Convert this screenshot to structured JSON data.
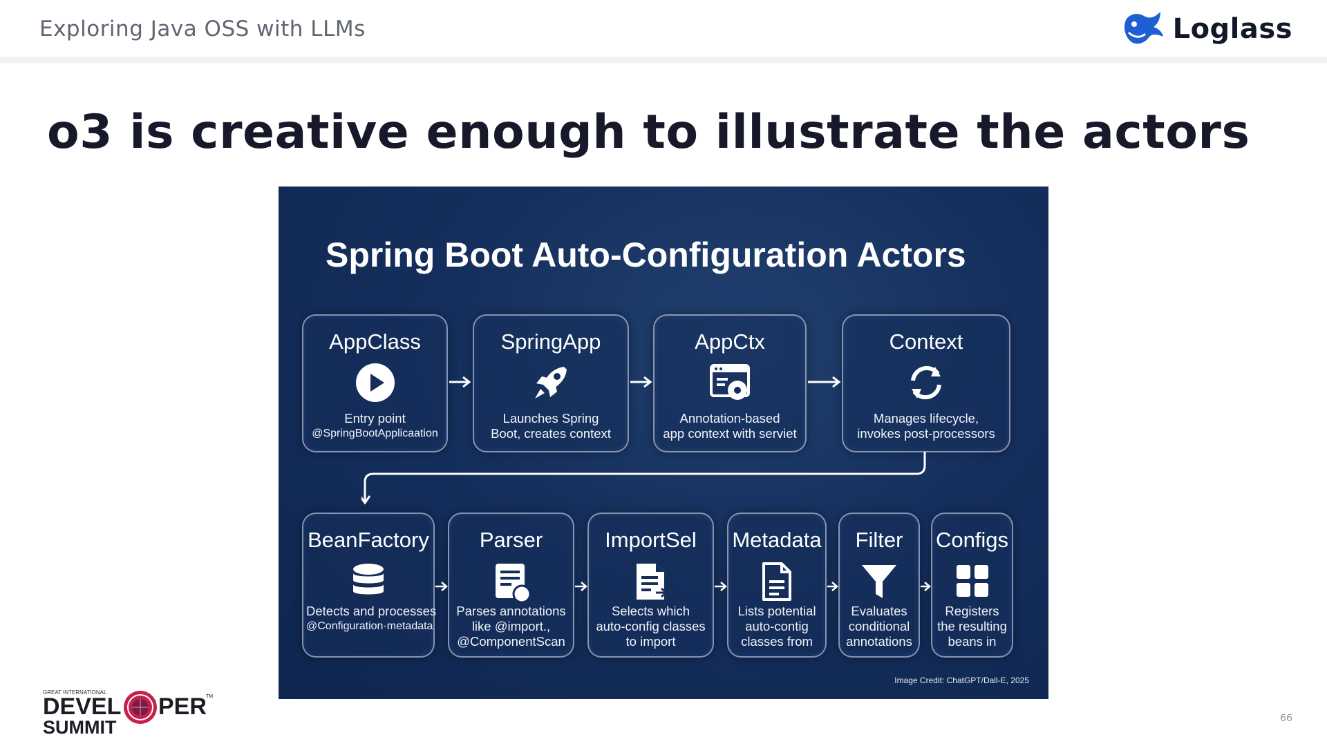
{
  "header": {
    "title": "Exploring Java OSS with LLMs",
    "brand": "Loglass"
  },
  "slide": {
    "title": "o3 is creative enough to illustrate the actors",
    "page_number": "66"
  },
  "figure": {
    "title": "Spring Boot Auto-Configuration Actors",
    "credit": "Image Credit: ChatGPT/Dall-E, 2025",
    "top_row": [
      {
        "title": "AppClass",
        "icon": "play-icon",
        "desc": [
          "Entry point",
          "@SpringBootApplicaation"
        ]
      },
      {
        "title": "SpringApp",
        "icon": "rocket-icon",
        "desc": [
          "Launches Spring",
          "Boot, creates context"
        ]
      },
      {
        "title": "AppCtx",
        "icon": "app-window-gear-icon",
        "desc": [
          "Annotation-based",
          "app context with serviet"
        ]
      },
      {
        "title": "Context",
        "icon": "refresh-cycle-icon",
        "desc": [
          "Manages lifecycle,",
          "invokes post-processors"
        ]
      }
    ],
    "bottom_row": [
      {
        "title": "BeanFactory",
        "icon": "database-icon",
        "desc": [
          "Detects and processes",
          "@Configuration·metadata"
        ]
      },
      {
        "title": "Parser",
        "icon": "document-parse-icon",
        "desc": [
          "Parses annotations",
          "like @import.,",
          "@ComponentScan"
        ]
      },
      {
        "title": "ImportSel",
        "icon": "document-import-icon",
        "desc": [
          "Selects which",
          "auto-config classes",
          "to import"
        ]
      },
      {
        "title": "Metadata",
        "icon": "file-icon",
        "desc": [
          "Lists potential",
          "auto-contig",
          "classes from"
        ]
      },
      {
        "title": "Filter",
        "icon": "funnel-icon",
        "desc": [
          "Evaluates",
          "conditional",
          "annotations"
        ]
      },
      {
        "title": "Configs",
        "icon": "grid-icon",
        "desc": [
          "Registers",
          "the resulting",
          "beans in"
        ]
      }
    ]
  },
  "footer": {
    "event_small": "GREAT INTERNATIONAL",
    "event_line1_a": "DEVEL",
    "event_line1_b": "PER",
    "event_line2": "SUMMIT",
    "trademark": "TM"
  },
  "colors": {
    "figure_bg": "#152f5c",
    "title_text": "#17192b",
    "brand_blue": "#1f5fd6",
    "logo_red": "#c8204d"
  }
}
